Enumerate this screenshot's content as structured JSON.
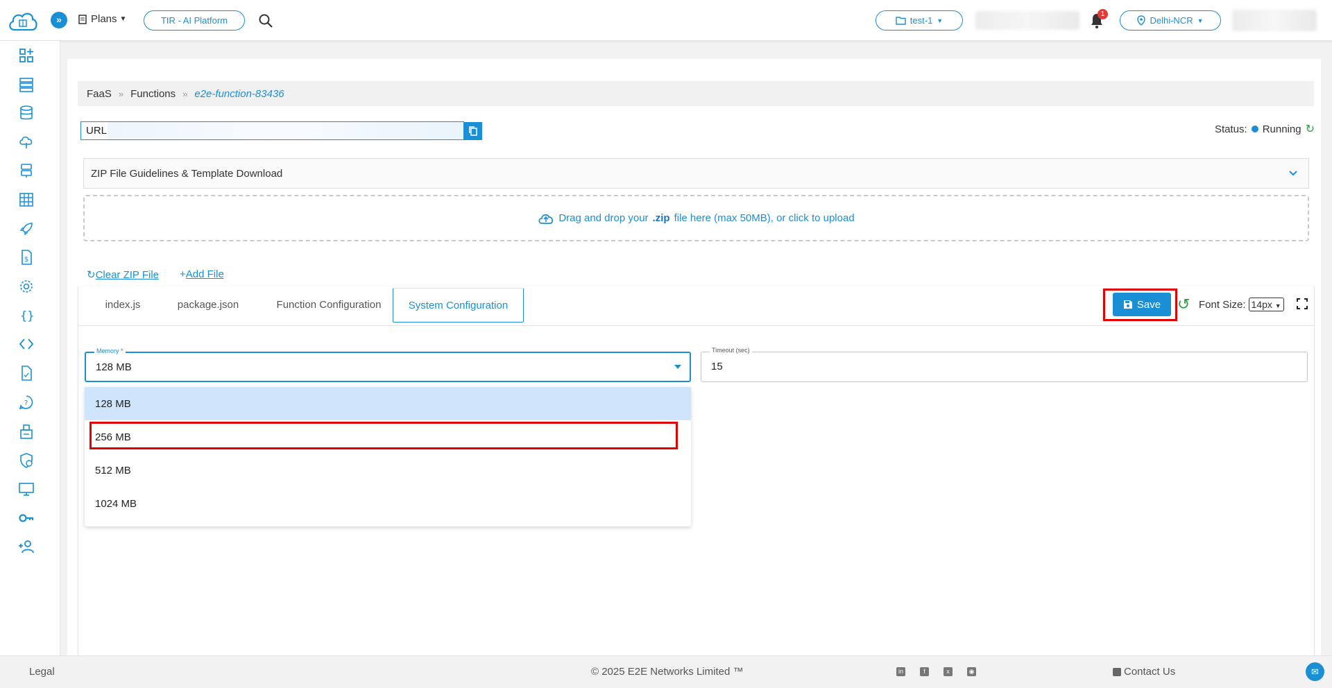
{
  "topbar": {
    "plans_label": "Plans",
    "tir_label": "TIR - AI Platform",
    "project_label": "test-1",
    "notification_count": "1",
    "region_label": "Delhi-NCR"
  },
  "sidebar": {
    "items": [
      {
        "icon": "dashboard-add-icon"
      },
      {
        "icon": "server-icon"
      },
      {
        "icon": "database-icon"
      },
      {
        "icon": "cloud-upload-icon"
      },
      {
        "icon": "storage-icon"
      },
      {
        "icon": "table-icon"
      },
      {
        "icon": "rocket-icon"
      },
      {
        "icon": "billing-icon"
      },
      {
        "icon": "settings-icon"
      },
      {
        "icon": "functions-braces-icon"
      },
      {
        "icon": "code-icon"
      },
      {
        "icon": "document-icon"
      },
      {
        "icon": "support-icon"
      },
      {
        "icon": "registry-icon"
      },
      {
        "icon": "security-icon"
      },
      {
        "icon": "monitor-icon"
      },
      {
        "icon": "key-icon"
      },
      {
        "icon": "add-user-icon"
      }
    ]
  },
  "breadcrumb": {
    "items": [
      "FaaS",
      "Functions"
    ],
    "separator": "»",
    "current": "e2e-function-83436"
  },
  "url": {
    "label": "URL"
  },
  "status": {
    "label": "Status:",
    "value": "Running"
  },
  "accordion": {
    "title": "ZIP File Guidelines & Template Download"
  },
  "dropzone": {
    "prefix": "Drag and drop your",
    "ext": ".zip",
    "suffix": "file here (max 50MB), or click to upload"
  },
  "zip_actions": {
    "clear_label": "Clear ZIP File",
    "add_label": "Add File"
  },
  "editor": {
    "tabs": [
      "index.js",
      "package.json",
      "Function Configuration",
      "System Configuration"
    ],
    "active_tab": "System Configuration",
    "save_label": "Save",
    "font_size_label": "Font Size:",
    "font_size_value": "14px"
  },
  "form": {
    "memory": {
      "label": "Memory *",
      "value": "128 MB",
      "options": [
        "128 MB",
        "256 MB",
        "512 MB",
        "1024 MB"
      ]
    },
    "timeout": {
      "label": "Timeout (sec)",
      "value": "15"
    }
  },
  "footer": {
    "legal": "Legal",
    "copyright_prefix": "© 2025",
    "copyright_company": "E2E Networks Limited ™",
    "contact": "Contact Us"
  },
  "colors": {
    "accent": "#1a8fd6",
    "running": "#1a8fd6",
    "highlight": "#e00000",
    "selected_option": "#cfe5fb"
  }
}
